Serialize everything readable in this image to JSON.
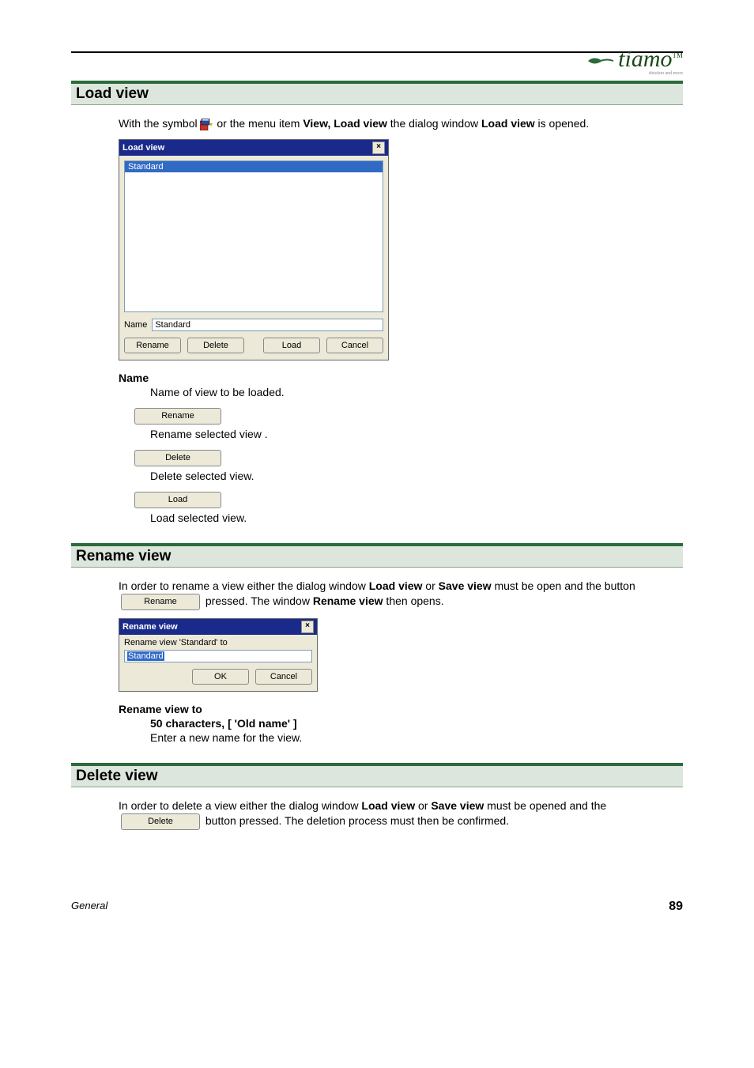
{
  "logo": {
    "brand": "tiamo",
    "tm": "TM",
    "tagline": "titration and more"
  },
  "sections": {
    "loadview": {
      "header": "Load view",
      "intro_pre": "With the symbol ",
      "intro_mid": " or the menu item ",
      "intro_menu": "View, Load view",
      "intro_post1": " the dialog window ",
      "intro_dlg": "Load view",
      "intro_post2": " is opened.",
      "dialog": {
        "title": "Load view",
        "list_item": "Standard",
        "name_label": "Name",
        "name_value": "Standard",
        "buttons": {
          "rename": "Rename",
          "delete": "Delete",
          "load": "Load",
          "cancel": "Cancel"
        }
      },
      "field_name": "Name",
      "field_name_desc": "Name of view to be loaded.",
      "rename_btn": "Rename",
      "rename_desc": "Rename selected view .",
      "delete_btn": "Delete",
      "delete_desc": "Delete selected view.",
      "load_btn": "Load",
      "load_desc": "Load selected view."
    },
    "renameview": {
      "header": "Rename view",
      "p1_pre": "In order to rename a view either the dialog window ",
      "p1_d1": "Load view",
      "p1_mid": " or ",
      "p1_d2": "Save view",
      "p1_post": " must be open and the button ",
      "p1_btn": "Rename",
      "p1_after": " pressed. The window ",
      "p1_d3": "Rename view",
      "p1_end": " then opens.",
      "dialog": {
        "title": "Rename view",
        "label": "Rename view 'Standard' to",
        "value": "Standard",
        "ok": "OK",
        "cancel": "Cancel"
      },
      "field_name": "Rename view to",
      "field_constraints": "50 characters, [ 'Old name' ]",
      "field_desc": "Enter a new name for the view."
    },
    "deleteview": {
      "header": "Delete view",
      "p1_pre": "In order to delete a view either the dialog window ",
      "p1_d1": "Load view",
      "p1_mid": " or ",
      "p1_d2": "Save view",
      "p1_post": " must be opened and the ",
      "p1_btn": "Delete",
      "p1_after": " button pressed. The deletion process must then be confirmed."
    }
  },
  "footer": {
    "left": "General",
    "right": "89"
  }
}
